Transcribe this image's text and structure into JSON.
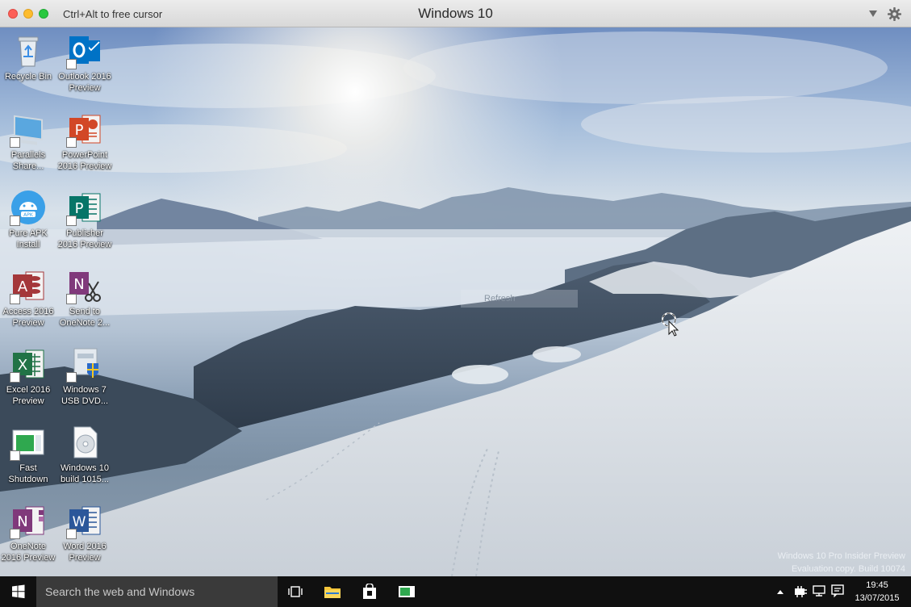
{
  "titlebar": {
    "hint": "Ctrl+Alt to free cursor",
    "title": "Windows 10"
  },
  "desktop": {
    "icons": [
      {
        "label": "Recycle Bin",
        "icon": "recycle-bin-icon"
      },
      {
        "label": "Outlook 2016\nPreview",
        "icon": "outlook-icon"
      },
      {
        "label": "Parallels\nShare...",
        "icon": "parallels-share-icon"
      },
      {
        "label": "PowerPoint\n2016 Preview",
        "icon": "powerpoint-icon"
      },
      {
        "label": "Pure APK\nInstall",
        "icon": "android-apk-icon"
      },
      {
        "label": "Publisher\n2016 Preview",
        "icon": "publisher-icon"
      },
      {
        "label": "Access 2016\nPreview",
        "icon": "access-icon"
      },
      {
        "label": "Send to\nOneNote 2...",
        "icon": "send-to-onenote-icon"
      },
      {
        "label": "Excel 2016\nPreview",
        "icon": "excel-icon"
      },
      {
        "label": "Windows 7\nUSB DVD...",
        "icon": "windows7-usb-dvd-icon"
      },
      {
        "label": "Fast\nShutdown",
        "icon": "fast-shutdown-icon"
      },
      {
        "label": "Windows 10\nbuild 1015...",
        "icon": "disc-image-icon"
      },
      {
        "label": "OneNote\n2016 Preview",
        "icon": "onenote-icon"
      },
      {
        "label": "Word 2016\nPreview",
        "icon": "word-icon"
      }
    ],
    "refresh_ghost": "Refresh",
    "watermark": {
      "line1": "Windows 10 Pro Insider Preview",
      "line2": "Evaluation copy. Build 10074"
    }
  },
  "taskbar": {
    "search_placeholder": "Search the web and Windows",
    "clock_time": "19:45",
    "clock_date": "13/07/2015"
  },
  "colors": {
    "taskbar": "#101010",
    "search_box": "#3a3a3a",
    "outlook": "#0072c6",
    "powerpoint": "#d24726",
    "publisher": "#077568",
    "access": "#a4373a",
    "excel": "#217346",
    "onenote": "#80397b",
    "word": "#2b579a"
  }
}
